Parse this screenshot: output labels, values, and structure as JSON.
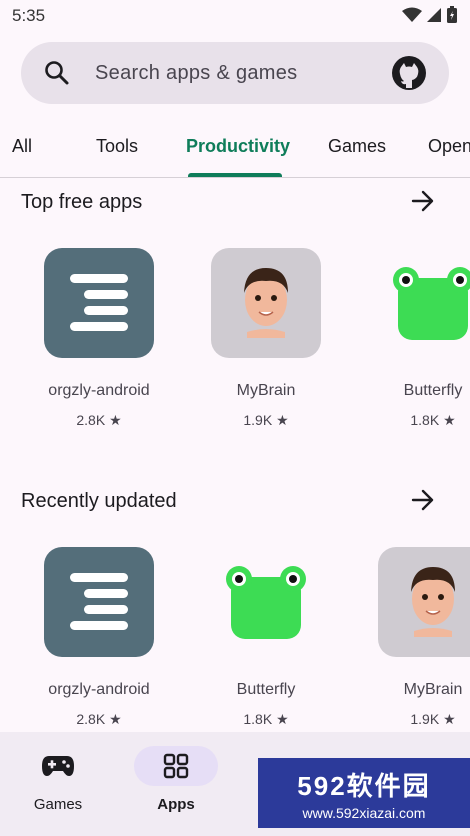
{
  "status": {
    "time": "5:35"
  },
  "search": {
    "placeholder": "Search apps & games"
  },
  "tabs": [
    {
      "label": "All"
    },
    {
      "label": "Tools"
    },
    {
      "label": "Productivity"
    },
    {
      "label": "Games"
    },
    {
      "label": "Open"
    }
  ],
  "sections": [
    {
      "title": "Top free apps",
      "apps": [
        {
          "name": "orgzly-android",
          "rating": "2.8K ★",
          "icon": "orgzly-icon"
        },
        {
          "name": "MyBrain",
          "rating": "1.9K ★",
          "icon": "mybrain-avatar-icon"
        },
        {
          "name": "Butterfly",
          "rating": "1.8K ★",
          "icon": "frog-icon"
        }
      ]
    },
    {
      "title": "Recently updated",
      "apps": [
        {
          "name": "orgzly-android",
          "rating": "2.8K ★",
          "icon": "orgzly-icon"
        },
        {
          "name": "Butterfly",
          "rating": "1.8K ★",
          "icon": "frog-icon"
        },
        {
          "name": "MyBrain",
          "rating": "1.9K ★",
          "icon": "mybrain-avatar-icon"
        }
      ]
    }
  ],
  "nav": [
    {
      "label": "Games",
      "icon": "gamepad-icon"
    },
    {
      "label": "Apps",
      "icon": "apps-grid-icon"
    }
  ],
  "watermark": {
    "brand": "592软件园",
    "url": "www.592xiazai.com"
  },
  "colors": {
    "accent": "#0f7d5a",
    "background": "#fdf7fc",
    "search_bg": "#e8e1ea",
    "nav_bg": "#f1ebf3",
    "orgzly_bg": "#546e7a",
    "frog_green": "#3ddc54"
  }
}
